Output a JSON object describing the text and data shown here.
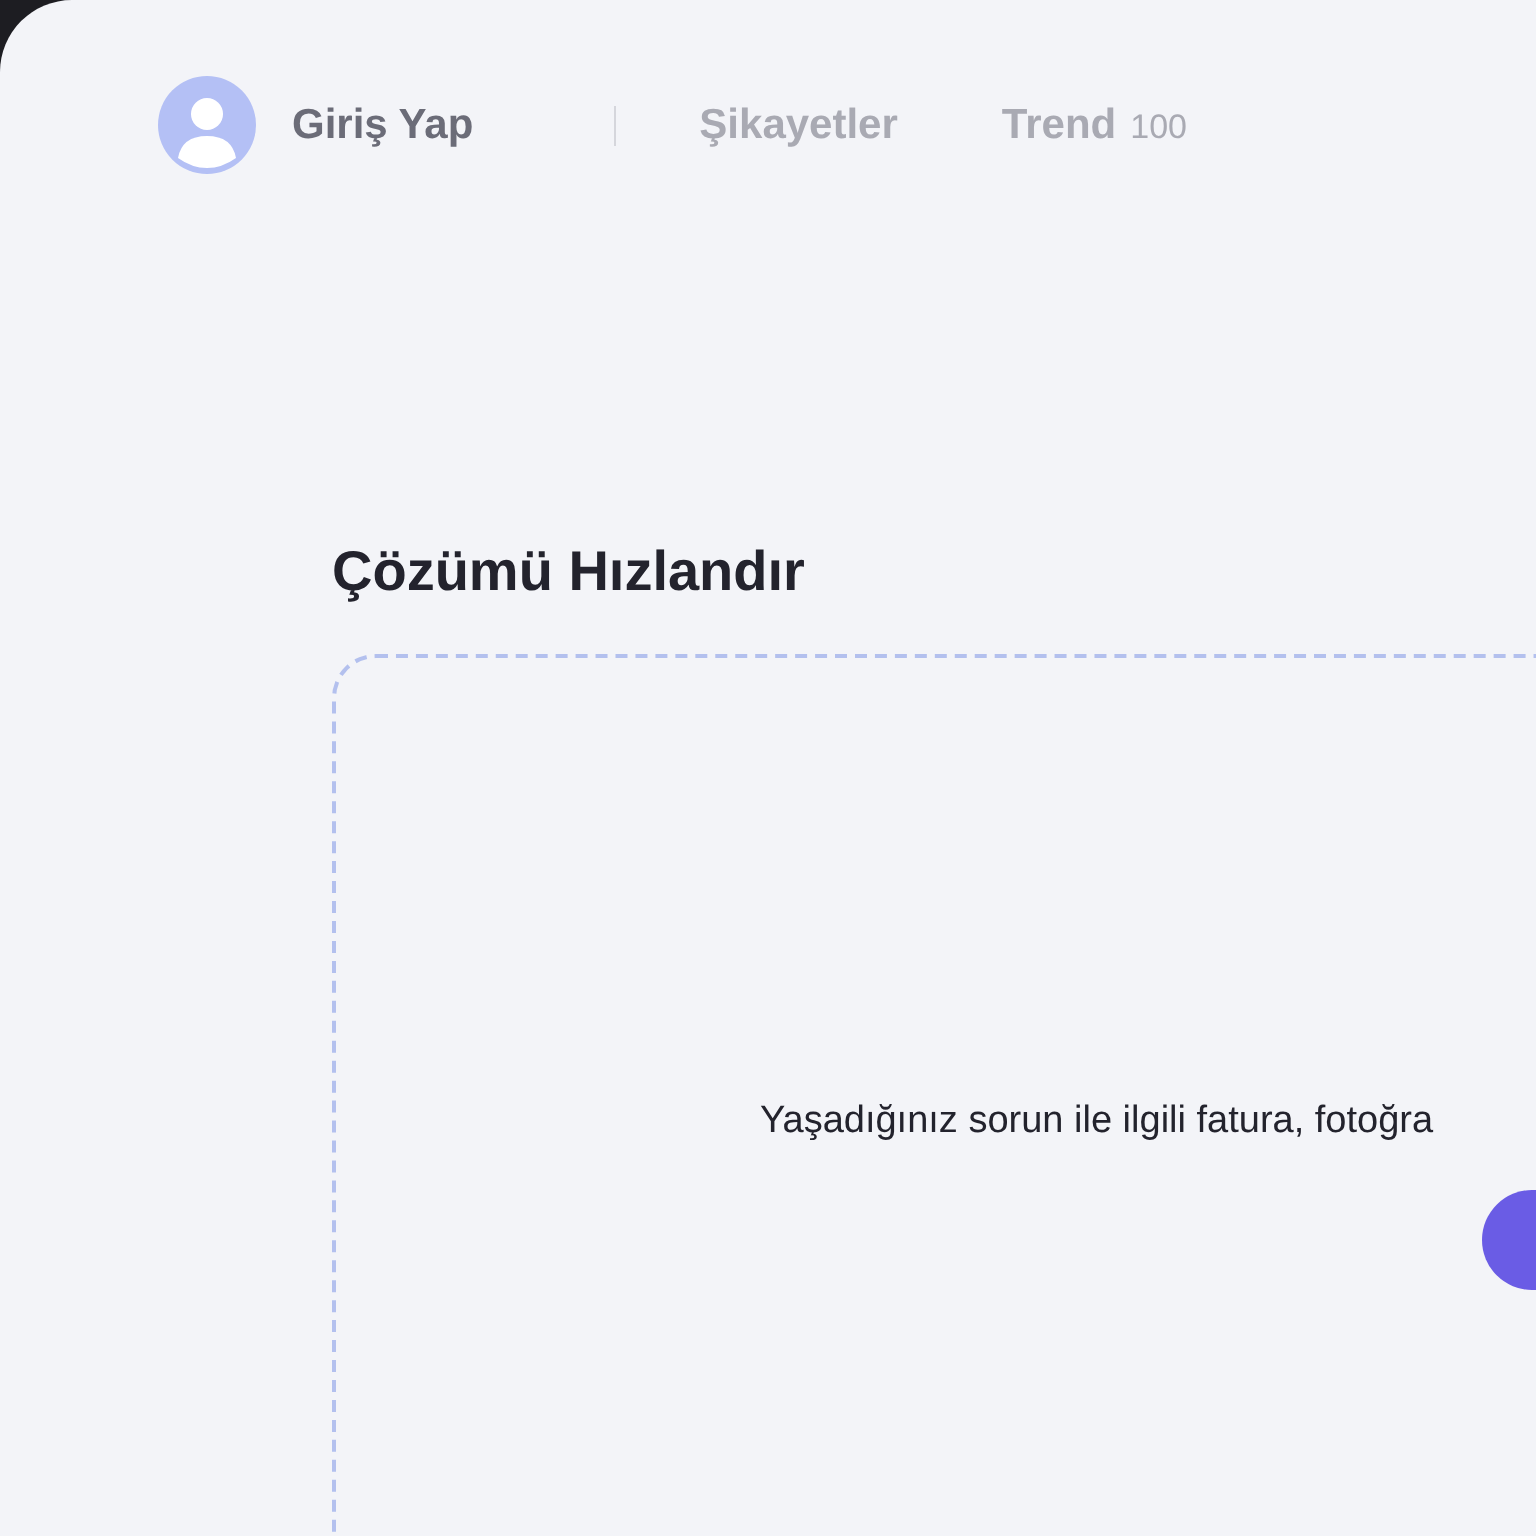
{
  "nav": {
    "login": "Giriş Yap",
    "links": [
      {
        "label": "Şikayetler"
      },
      {
        "label": "Trend",
        "count": "100"
      }
    ]
  },
  "title": "Çözümü Hızlandır",
  "upload": {
    "text": "Yaşadığınız sorun ile ilgili fatura, fotoğra"
  }
}
